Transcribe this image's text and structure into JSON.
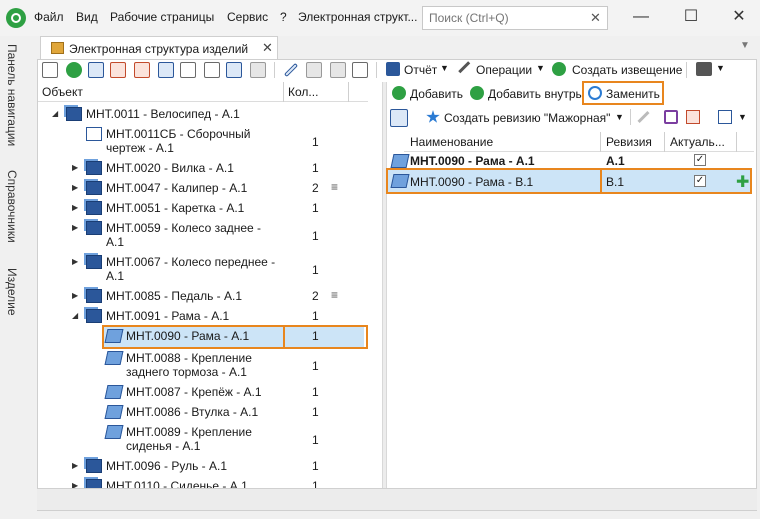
{
  "menu": [
    "Файл",
    "Вид",
    "Рабочие страницы",
    "Сервис",
    "?",
    "Электронная структ..."
  ],
  "search": {
    "placeholder": "Поиск (Ctrl+Q)"
  },
  "window": {
    "minimize": "—",
    "maximize": "☐",
    "close": "✕"
  },
  "leftnav": [
    "Панель навигации",
    "Справочники",
    "Изделие"
  ],
  "tab": {
    "title": "Электронная структура изделий",
    "close": "✕"
  },
  "tree": {
    "columns": {
      "object": "Объект",
      "qty": "Кол..."
    },
    "rows": [
      {
        "label": "МНТ.0011 - Велосипед - А.1",
        "qty": "",
        "icon": "asm"
      },
      {
        "label": "МНТ.0011СБ - Сборочный чертеж - А.1",
        "qty": "1",
        "icon": "doc"
      },
      {
        "label": "МНТ.0020 - Вилка - А.1",
        "qty": "1",
        "icon": "asm"
      },
      {
        "label": "МНТ.0047 - Калипер - А.1",
        "qty": "2",
        "icon": "asm"
      },
      {
        "label": "МНТ.0051 - Каретка - А.1",
        "qty": "1",
        "icon": "asm"
      },
      {
        "label": "МНТ.0059 - Колесо заднее - А.1",
        "qty": "1",
        "icon": "asm"
      },
      {
        "label": "МНТ.0067 - Колесо переднее - А.1",
        "qty": "1",
        "icon": "asm"
      },
      {
        "label": "МНТ.0085 - Педаль - А.1",
        "qty": "2",
        "icon": "asm"
      },
      {
        "label": "МНТ.0091 - Рама - А.1",
        "qty": "1",
        "icon": "asm"
      },
      {
        "label": "МНТ.0090 - Рама - А.1",
        "qty": "1",
        "icon": "part"
      },
      {
        "label": "МНТ.0088 - Крепление заднего тормоза - А.1",
        "qty": "1",
        "icon": "part"
      },
      {
        "label": "МНТ.0087 - Крепёж - А.1",
        "qty": "1",
        "icon": "part"
      },
      {
        "label": "МНТ.0086 - Втулка - А.1",
        "qty": "1",
        "icon": "part"
      },
      {
        "label": "МНТ.0089 - Крепление сиденья - А.1",
        "qty": "1",
        "icon": "part"
      },
      {
        "label": "МНТ.0096 - Руль - А.1",
        "qty": "1",
        "icon": "asm"
      },
      {
        "label": "МНТ.0110 - Сиденье - А.1",
        "qty": "1",
        "icon": "asm"
      }
    ]
  },
  "right_toolbar": {
    "report": "Отчёт",
    "operations": "Операции",
    "create_notice": "Создать извещение",
    "add": "Добавить",
    "add_inside": "Добавить внутрь",
    "replace": "Заменить",
    "create_revision": "Создать ревизию \"Мажорная\""
  },
  "grid": {
    "columns": {
      "name": "Наименование",
      "revision": "Ревизия",
      "actual": "Актуаль..."
    },
    "rows": [
      {
        "name": "МНТ.0090 - Рама - А.1",
        "revision": "А.1",
        "actual": "✓"
      },
      {
        "name": "МНТ.0090 - Рама - В.1",
        "revision": "В.1",
        "actual": "✓"
      }
    ]
  },
  "colors": {
    "accent_orange": "#e8861e",
    "selection": "#cce4f7",
    "green": "#2ea043",
    "blue": "#2b579a"
  }
}
